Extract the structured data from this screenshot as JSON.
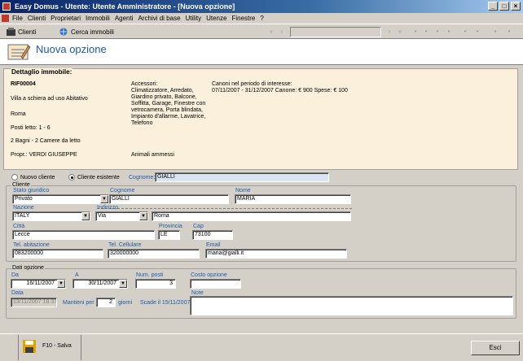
{
  "window": {
    "title": "Easy Domus - Utente: Utente Amministratore - [Nuova opzione]",
    "minimize": "_",
    "restore": "□",
    "close": "×"
  },
  "menu": [
    "File",
    "Clienti",
    "Proprietari",
    "Immobili",
    "Agenti",
    "Archivi di base",
    "Utility",
    "Utenze",
    "Finestre",
    "?"
  ],
  "toolbar": {
    "clienti": "Clienti",
    "cerca": "Cerca immobili"
  },
  "header": {
    "title": "Nuova opzione"
  },
  "dettaglio": {
    "legend": "Dettaglio immobile:",
    "code": "RIF00004",
    "tipo": "Villa a schiera ad uso Abitativo",
    "citta": "Roma",
    "posti": "Posti letto: 1 - 6",
    "bagni": "2 Bagni -  2 Camere da letto",
    "propr": "Propr.: VERDI GIUSEPPE",
    "accessori_label": "Accessori:",
    "accessori": [
      "Climatizzatore, Arredato,",
      "Giardino privato, Balcone,",
      "Soffitta, Garage, Finestre con",
      "vetrocamera, Porta blindata,",
      "Impianto d'allarme, Lavatrice,",
      "Telefono"
    ],
    "animali": "Animali ammessi",
    "canoni_label": "Canoni nel periodo di interesse:",
    "canoni": "07/11/2007 - 31/12/2007 Canone: € 900 Spese: € 100"
  },
  "radios": {
    "nuovo": "Nuovo cliente",
    "esistente": "Cliente esistente",
    "cognome_label": "Cognome:",
    "cognome_value": "GIALLI",
    "selected": "esistente"
  },
  "cliente": {
    "legend": "Cliente",
    "stato_label": "Stato giuridico",
    "stato": "Privato",
    "cognome_label": "Cognome",
    "cognome": "GIALLI",
    "nome_label": "Nome",
    "nome": "MARIA",
    "nazione_label": "Nazione",
    "nazione": "ITALY",
    "indirizzo_label": "Indirizzo",
    "via": "Via",
    "indirizzo": "Roma",
    "citta_label": "Città",
    "citta": "Lecce",
    "provincia_label": "Provincia",
    "provincia": "LE",
    "cap_label": "Cap",
    "cap": "73100",
    "tel_label": "Tel. abitazione",
    "tel": "083200000",
    "cell_label": "Tel. Cellulare",
    "cell": "320000000",
    "email_label": "Email",
    "email": "maria@gialli.it"
  },
  "opzione": {
    "legend": "Dati opzione",
    "da_label": "Da",
    "da": "16/11/2007",
    "a_label": "A",
    "a": "30/11/2007",
    "posti_label": "Num. posti",
    "posti": "3",
    "costo_label": "Costo opzione",
    "costo": "",
    "data_label": "Data",
    "data": "13/11/2007 18.37",
    "mantieni_label": "Mantieni per",
    "mantieni": "2",
    "giorni": "giorni",
    "scade": "Scade il 15/11/2007",
    "note_label": "Note",
    "note": ""
  },
  "footer": {
    "salva": "F10 - Salva",
    "esci": "Esci"
  }
}
